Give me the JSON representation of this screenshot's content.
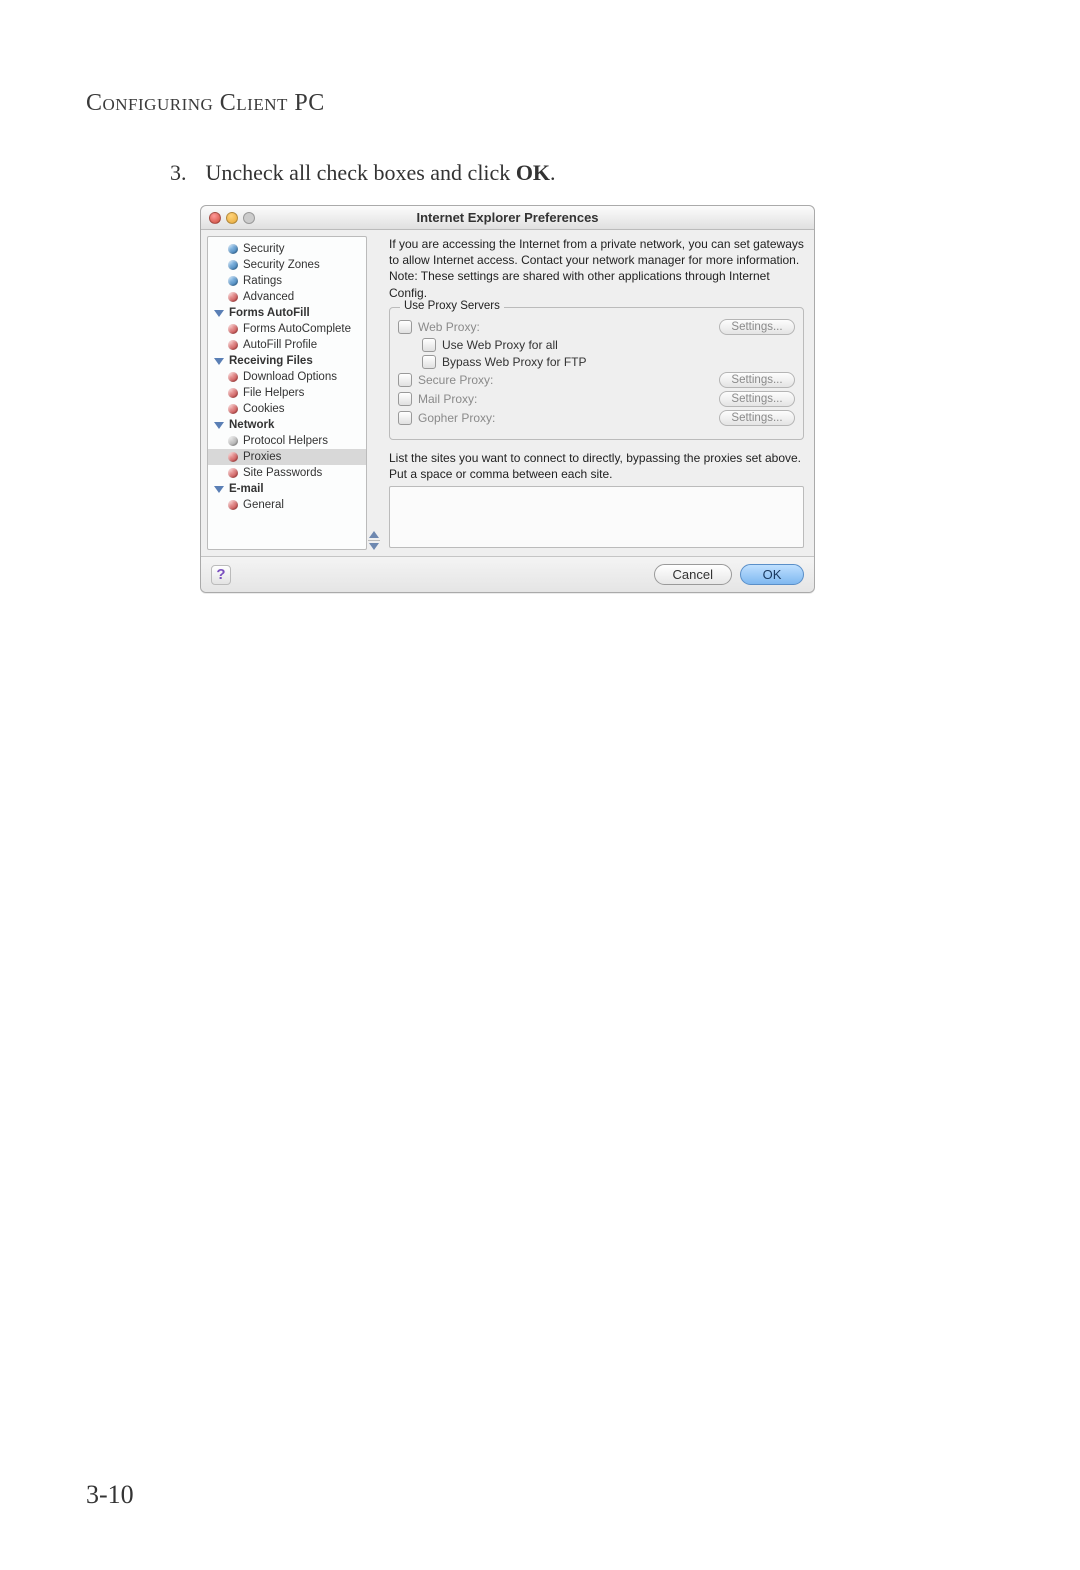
{
  "page": {
    "header": "Configuring Client PC",
    "step_number": "3.",
    "instruction_pre": "Uncheck all check boxes and click ",
    "instruction_bold": "OK",
    "instruction_post": ".",
    "page_number": "3-10"
  },
  "window": {
    "title": "Internet Explorer Preferences",
    "intro": "If you are accessing the Internet from a private network, you can set gateways to allow Internet access.  Contact your network manager for more information.  Note: These settings are shared with other applications through Internet Config.",
    "group_legend": "Use Proxy Servers",
    "proxies": {
      "web_label": "Web Proxy:",
      "use_web_all": "Use Web Proxy for all",
      "bypass_ftp": "Bypass Web Proxy for FTP",
      "secure_label": "Secure Proxy:",
      "mail_label": "Mail Proxy:",
      "gopher_label": "Gopher Proxy:",
      "settings_btn": "Settings..."
    },
    "bypass_note": "List the sites you want to connect to directly,  bypassing the proxies set above.  Put a space or comma between each site.",
    "buttons": {
      "help": "?",
      "cancel": "Cancel",
      "ok": "OK"
    }
  },
  "sidebar": [
    {
      "type": "item",
      "label": "Security",
      "bullet": "blue"
    },
    {
      "type": "item",
      "label": "Security Zones",
      "bullet": "blue"
    },
    {
      "type": "item",
      "label": "Ratings",
      "bullet": "blue"
    },
    {
      "type": "item",
      "label": "Advanced",
      "bullet": "red"
    },
    {
      "type": "group",
      "label": "Forms AutoFill"
    },
    {
      "type": "item",
      "label": "Forms AutoComplete",
      "bullet": "red"
    },
    {
      "type": "item",
      "label": "AutoFill Profile",
      "bullet": "red"
    },
    {
      "type": "group",
      "label": "Receiving Files"
    },
    {
      "type": "item",
      "label": "Download Options",
      "bullet": "red"
    },
    {
      "type": "item",
      "label": "File Helpers",
      "bullet": "red"
    },
    {
      "type": "item",
      "label": "Cookies",
      "bullet": "red"
    },
    {
      "type": "group",
      "label": "Network"
    },
    {
      "type": "item",
      "label": "Protocol Helpers",
      "bullet": "grey"
    },
    {
      "type": "item",
      "label": "Proxies",
      "bullet": "red",
      "selected": true
    },
    {
      "type": "item",
      "label": "Site Passwords",
      "bullet": "red"
    },
    {
      "type": "group",
      "label": "E-mail"
    },
    {
      "type": "item",
      "label": "General",
      "bullet": "red"
    }
  ]
}
